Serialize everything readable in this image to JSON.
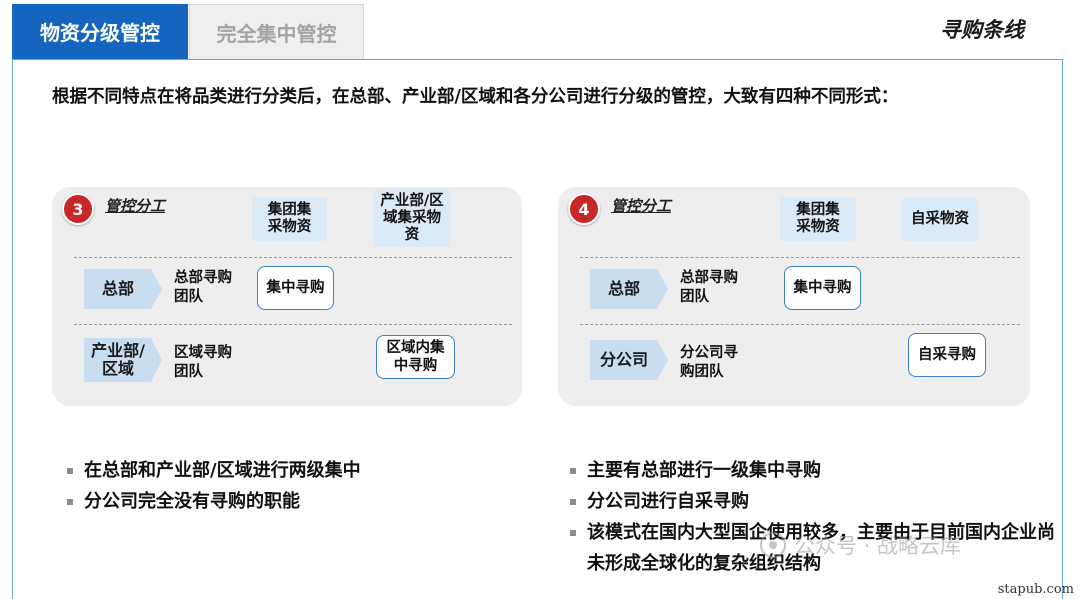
{
  "tabs": [
    {
      "label": "物资分级管控",
      "active": true
    },
    {
      "label": "完全集中管控",
      "active": false
    }
  ],
  "section_title": "寻购条线",
  "intro": "根据不同特点在将品类进行分类后，在总部、产业部/区域和各分公司进行分级的管控，大致有四种不同形式：",
  "panels": [
    {
      "number": "3",
      "mgmt_label": "管控分工",
      "categories": [
        "集团集采物资",
        "产业部/区域集采物资"
      ],
      "rows": [
        {
          "org": "总部",
          "desc": "总部寻购团队",
          "mode": "集中寻购"
        },
        {
          "org": "产业部/区域",
          "desc": "区域寻购团队",
          "mode": "区域内集中寻购"
        }
      ]
    },
    {
      "number": "4",
      "mgmt_label": "管控分工",
      "categories": [
        "集团集采物资",
        "自采物资"
      ],
      "rows": [
        {
          "org": "总部",
          "desc": "总部寻购团队",
          "mode": "集中寻购"
        },
        {
          "org": "分公司",
          "desc": "分公司寻购团队",
          "mode": "自采寻购"
        }
      ]
    }
  ],
  "bullets_left": [
    "在总部和产业部/区域进行两级集中",
    "分公司完全没有寻购的职能"
  ],
  "bullets_right": [
    "主要有总部进行一级集中寻购",
    "分公司进行自采寻购",
    "该模式在国内大型国企使用较多，主要由于目前国内企业尚未形成全球化的复杂组织结构"
  ],
  "watermark": "公众号 · 战略云库",
  "site_mark": "stapub.com",
  "colors": {
    "tab_active": "#1565c0",
    "badge": "#c62828",
    "category_fill": "#dbeaf7",
    "org_arrow": "#c9ddf1",
    "mode_border": "#3b7fc4"
  }
}
